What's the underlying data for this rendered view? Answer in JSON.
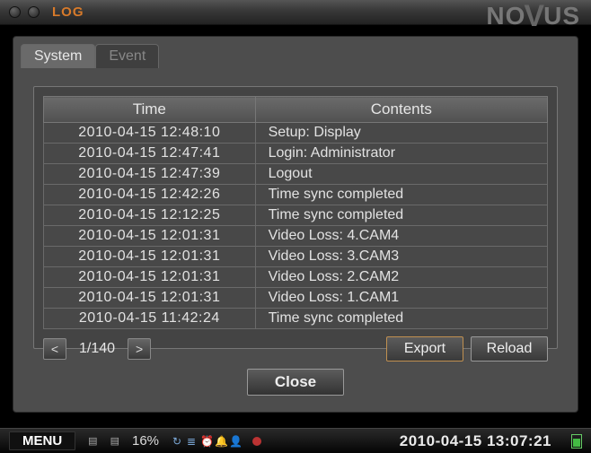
{
  "titlebar": {
    "title": "LOG"
  },
  "brand": {
    "pre": "NO",
    "v": "V",
    "post": "US"
  },
  "tabs": [
    {
      "label": "System",
      "active": true
    },
    {
      "label": "Event",
      "active": false
    }
  ],
  "table": {
    "headers": {
      "time": "Time",
      "contents": "Contents"
    },
    "rows": [
      {
        "time": "2010-04-15  12:48:10",
        "contents": "Setup: Display"
      },
      {
        "time": "2010-04-15  12:47:41",
        "contents": "Login: Administrator"
      },
      {
        "time": "2010-04-15  12:47:39",
        "contents": "Logout"
      },
      {
        "time": "2010-04-15  12:42:26",
        "contents": "Time sync completed"
      },
      {
        "time": "2010-04-15  12:12:25",
        "contents": "Time sync completed"
      },
      {
        "time": "2010-04-15  12:01:31",
        "contents": "Video Loss: 4.CAM4"
      },
      {
        "time": "2010-04-15  12:01:31",
        "contents": "Video Loss: 3.CAM3"
      },
      {
        "time": "2010-04-15  12:01:31",
        "contents": "Video Loss: 2.CAM2"
      },
      {
        "time": "2010-04-15  12:01:31",
        "contents": "Video Loss: 1.CAM1"
      },
      {
        "time": "2010-04-15  11:42:24",
        "contents": "Time sync completed"
      }
    ]
  },
  "pagination": {
    "prev": "<",
    "label": "1/140",
    "next": ">"
  },
  "buttons": {
    "export": "Export",
    "reload": "Reload",
    "close": "Close"
  },
  "status": {
    "menu": "MENU",
    "disk_pct": "16%",
    "clock": "2010-04-15 13:07:21"
  }
}
